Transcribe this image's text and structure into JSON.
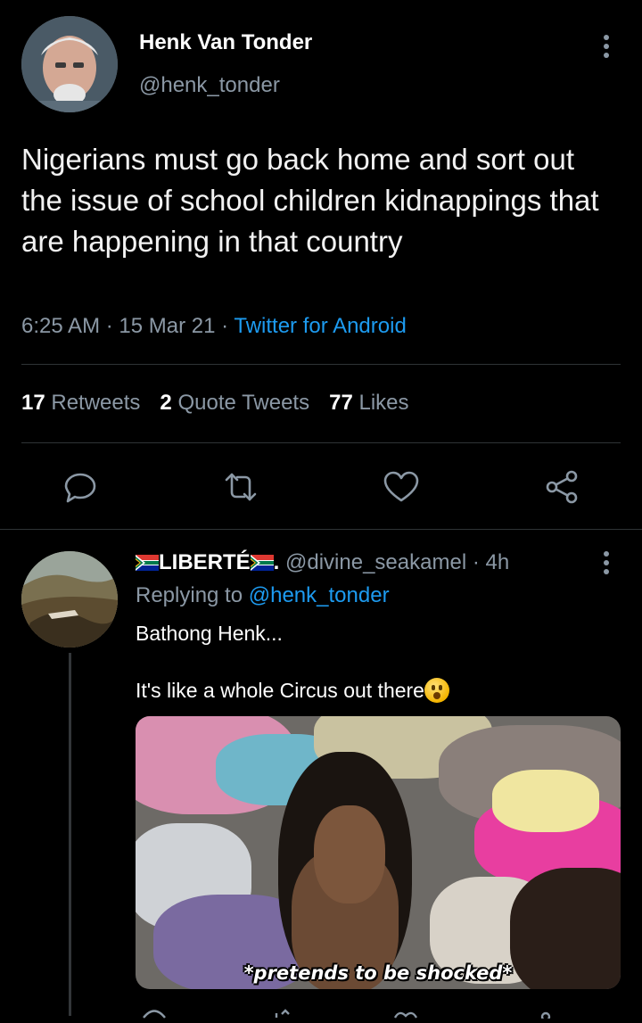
{
  "tweet": {
    "author_name": "Henk Van Tonder",
    "author_handle": "@henk_tonder",
    "text": "Nigerians must go back home and sort out the issue of school children kidnappings that are happening in that country",
    "time": "6:25 AM",
    "date": "15 Mar 21",
    "source": "Twitter for Android",
    "separator": "·"
  },
  "stats": {
    "retweets_count": "17",
    "retweets_label": "Retweets",
    "quote_tweets_count": "2",
    "quote_tweets_label": "Quote Tweets",
    "likes_count": "77",
    "likes_label": "Likes"
  },
  "actions": {
    "icons": [
      "reply-icon",
      "retweet-icon",
      "like-icon",
      "share-icon"
    ]
  },
  "reply": {
    "author_name": "LIBERTÉ",
    "name_suffix": ".",
    "author_handle": "@divine_seakamel",
    "time_ago": "4h",
    "replying_to_label": "Replying to",
    "replying_to_handle": "@henk_tonder",
    "text_line1": "Bathong Henk...",
    "text_line2": "It's like a whole Circus out there",
    "media_caption": "*pretends to be shocked*"
  },
  "colors": {
    "background": "#000000",
    "accent": "#1d9bf0",
    "secondary_text": "#8b98a5",
    "divider": "#2f3336"
  }
}
